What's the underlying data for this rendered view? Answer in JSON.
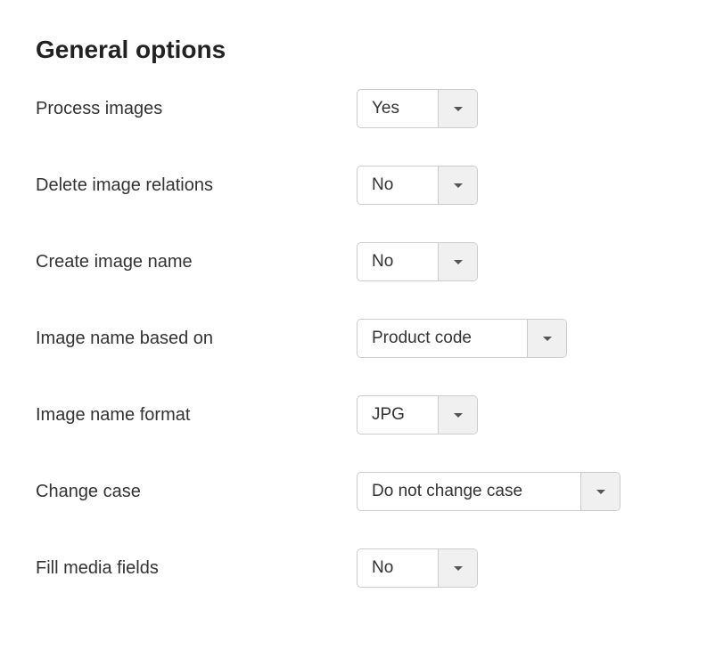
{
  "heading": "General options",
  "fields": {
    "process_images": {
      "label": "Process images",
      "value": "Yes"
    },
    "delete_image_relations": {
      "label": "Delete image relations",
      "value": "No"
    },
    "create_image_name": {
      "label": "Create image name",
      "value": "No"
    },
    "image_name_based_on": {
      "label": "Image name based on",
      "value": "Product code"
    },
    "image_name_format": {
      "label": "Image name format",
      "value": "JPG"
    },
    "change_case": {
      "label": "Change case",
      "value": "Do not change case"
    },
    "fill_media_fields": {
      "label": "Fill media fields",
      "value": "No"
    }
  }
}
